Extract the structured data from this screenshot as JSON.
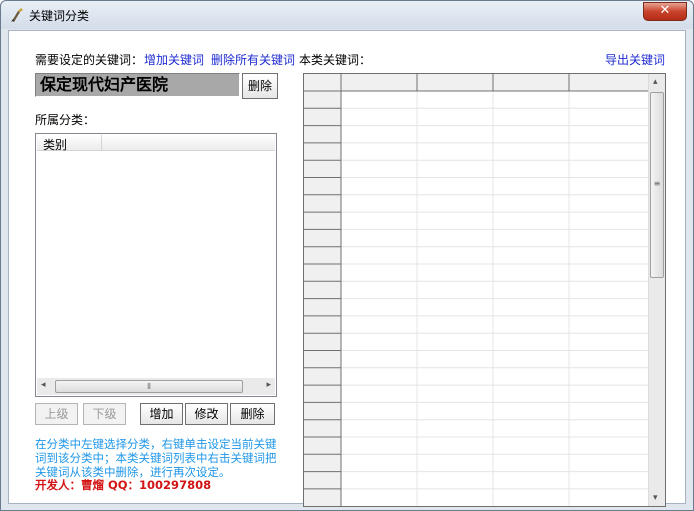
{
  "window": {
    "title": "关键词分类",
    "close_glyph": "✕"
  },
  "keyword_section": {
    "label": "需要设定的关键词：",
    "add_link": "增加关键词",
    "delete_all_link": "删除所有关键词",
    "current_keyword": "保定现代妇产医院",
    "delete_button": "删除"
  },
  "category_section": {
    "label": "所属分类：",
    "column_header": "类别",
    "hscroll_grip": "⦀",
    "hscroll_left": "◂",
    "hscroll_right": "▸",
    "buttons": {
      "up": "上级",
      "down": "下级",
      "add": "增加",
      "edit": "修改",
      "delete": "删除"
    }
  },
  "hint_text": "在分类中左键选择分类，右键单击设定当前关键词到该分类中；本类关键词列表中右击关键词把关键词从该类中删除，进行再次设定。",
  "developer": "开发人：曹熘 QQ：100297808",
  "class_keywords": {
    "label": "本类关键词：",
    "export_link": "导出关键词",
    "vscroll_grip": "≡",
    "vscroll_up": "▴",
    "vscroll_down": "▾"
  }
}
